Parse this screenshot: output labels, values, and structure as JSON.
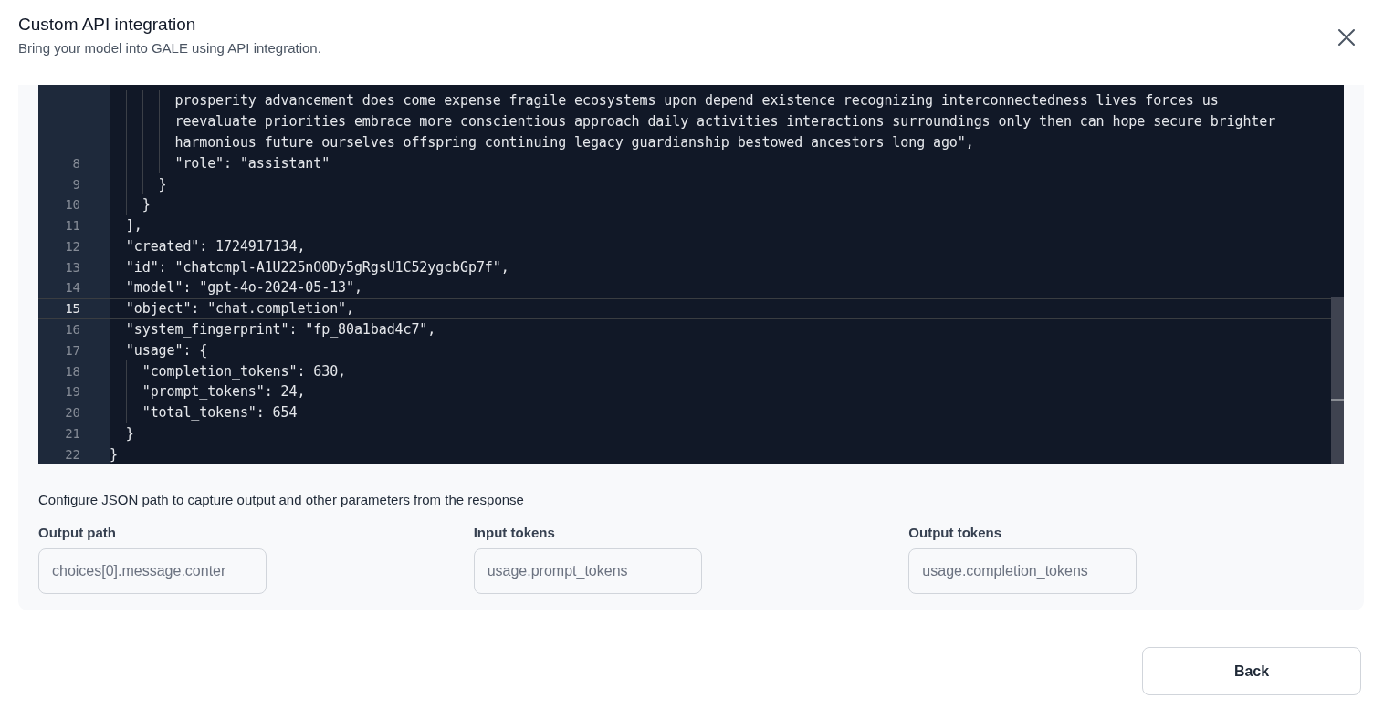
{
  "dialog": {
    "title": "Custom API integration",
    "subtitle": "Bring your model into GALE using API integration."
  },
  "code_lines": [
    {
      "text": "        prosperity advancement does come expense fragile ecosystems upon depend existence recognizing interconnectedness lives forces us",
      "current": false
    },
    {
      "text": "        reevaluate priorities embrace more conscientious approach daily activities interactions surroundings only then can hope secure brighter",
      "current": false
    },
    {
      "text": "        harmonious future ourselves offspring continuing legacy guardianship bestowed ancestors long ago\",",
      "current": false
    },
    {
      "number": "8",
      "text": "        \"role\": \"assistant\"",
      "current": false
    },
    {
      "number": "9",
      "text": "      }",
      "current": false
    },
    {
      "number": "10",
      "text": "    }",
      "current": false
    },
    {
      "number": "11",
      "text": "  ],",
      "current": false
    },
    {
      "number": "12",
      "text": "  \"created\": 1724917134,",
      "current": false
    },
    {
      "number": "13",
      "text": "  \"id\": \"chatcmpl-A1U225nO0Dy5gRgsU1C52ygcbGp7f\",",
      "current": false
    },
    {
      "number": "14",
      "text": "  \"model\": \"gpt-4o-2024-05-13\",",
      "current": false
    },
    {
      "number": "15",
      "text": "  \"object\": \"chat.completion\",",
      "current": true
    },
    {
      "number": "16",
      "text": "  \"system_fingerprint\": \"fp_80a1bad4c7\",",
      "current": false
    },
    {
      "number": "17",
      "text": "  \"usage\": {",
      "current": false
    },
    {
      "number": "18",
      "text": "    \"completion_tokens\": 630,",
      "current": false
    },
    {
      "number": "19",
      "text": "    \"prompt_tokens\": 24,",
      "current": false
    },
    {
      "number": "20",
      "text": "    \"total_tokens\": 654",
      "current": false
    },
    {
      "number": "21",
      "text": "  }",
      "current": false
    },
    {
      "number": "22",
      "text": "}",
      "current": false
    }
  ],
  "config_text": "Configure JSON path to capture output and other parameters from the response",
  "fields": [
    {
      "label": "Output path",
      "value": "choices[0].message.conter"
    },
    {
      "label": "Input tokens",
      "value": "usage.prompt_tokens"
    },
    {
      "label": "Output tokens",
      "value": "usage.completion_tokens"
    }
  ],
  "buttons": [
    "Back"
  ]
}
